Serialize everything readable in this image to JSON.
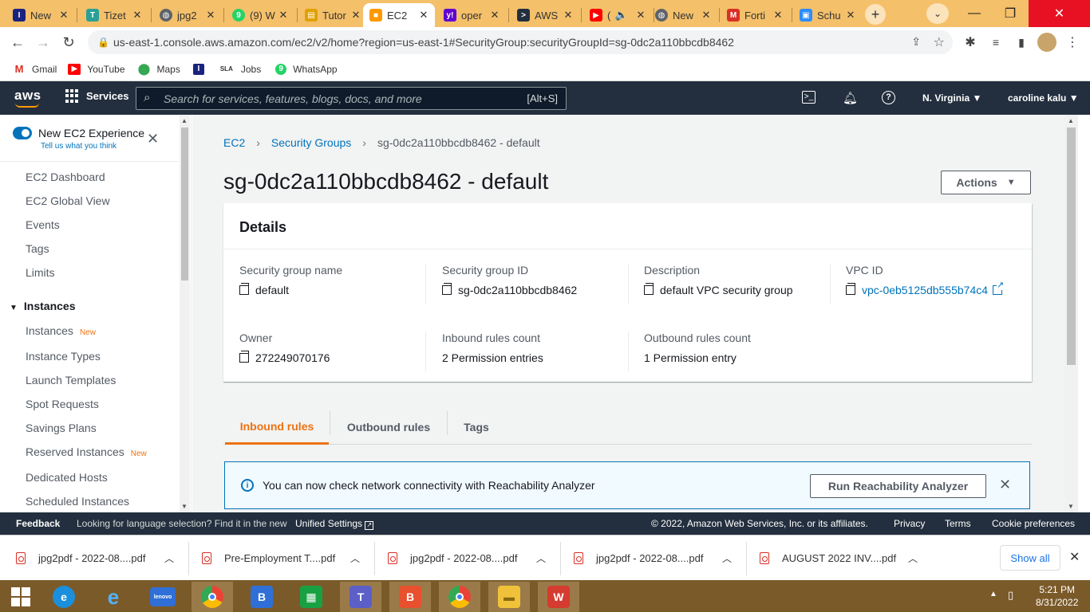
{
  "browser": {
    "tabs": [
      {
        "title": "New",
        "icon": "indeed-icon",
        "color": "#1a237e"
      },
      {
        "title": "Tizet",
        "icon": "tizeti-icon",
        "color": "#2aa198"
      },
      {
        "title": "jpg2",
        "icon": "globe-icon",
        "color": "#5f6368"
      },
      {
        "title": "(9) W",
        "icon": "whatsapp-icon",
        "color": "#25d366"
      },
      {
        "title": "Tutor",
        "icon": "tutorial-icon",
        "color": "#e0a100"
      },
      {
        "title": "EC2",
        "icon": "aws-cube-icon",
        "color": "#ff9900",
        "active": true
      },
      {
        "title": "oper",
        "icon": "yahoo-icon",
        "color": "#5f01d1"
      },
      {
        "title": "AWS",
        "icon": "terminal-icon",
        "color": "#232f3e"
      },
      {
        "title": "(",
        "icon": "youtube-icon",
        "color": "#ff0000"
      },
      {
        "title": "New",
        "icon": "globe-icon",
        "color": "#5f6368"
      },
      {
        "title": "Forti",
        "icon": "gmail-icon",
        "color": "#d93025"
      },
      {
        "title": "Schu",
        "icon": "zoom-icon",
        "color": "#2d8cff"
      }
    ],
    "url": "us-east-1.console.aws.amazon.com/ec2/v2/home?region=us-east-1#SecurityGroup:securityGroupId=sg-0dc2a110bbcdb8462",
    "bookmarks": [
      {
        "label": "Gmail",
        "icon": "gmail-icon"
      },
      {
        "label": "YouTube",
        "icon": "youtube-icon"
      },
      {
        "label": "Maps",
        "icon": "maps-icon"
      },
      {
        "label": "",
        "icon": "indeed-icon"
      },
      {
        "label": "Jobs",
        "icon": "jobs-icon"
      },
      {
        "label": "WhatsApp",
        "icon": "whatsapp-icon"
      }
    ]
  },
  "aws_header": {
    "logo": "aws",
    "services": "Services",
    "search_placeholder": "Search for services, features, blogs, docs, and more",
    "search_shortcut": "[Alt+S]",
    "region": "N. Virginia",
    "user": "caroline kalu"
  },
  "sidebar": {
    "toggle_label": "New EC2 Experience",
    "tell_us": "Tell us what you think",
    "top_items": [
      "EC2 Dashboard",
      "EC2 Global View",
      "Events",
      "Tags",
      "Limits"
    ],
    "section": "Instances",
    "section_items": [
      {
        "label": "Instances",
        "badge": "New"
      },
      {
        "label": "Instance Types",
        "badge": ""
      },
      {
        "label": "Launch Templates",
        "badge": ""
      },
      {
        "label": "Spot Requests",
        "badge": ""
      },
      {
        "label": "Savings Plans",
        "badge": ""
      },
      {
        "label": "Reserved Instances",
        "badge": "New"
      },
      {
        "label": "Dedicated Hosts",
        "badge": ""
      },
      {
        "label": "Scheduled Instances",
        "badge": ""
      }
    ]
  },
  "main": {
    "breadcrumb": [
      "EC2",
      "Security Groups",
      "sg-0dc2a110bbcdb8462 - default"
    ],
    "title": "sg-0dc2a110bbcdb8462 - default",
    "actions_label": "Actions",
    "details": {
      "heading": "Details",
      "fields": [
        {
          "label": "Security group name",
          "value": "default",
          "copy": true
        },
        {
          "label": "Security group ID",
          "value": "sg-0dc2a110bbcdb8462",
          "copy": true
        },
        {
          "label": "Description",
          "value": "default VPC security group",
          "copy": true
        },
        {
          "label": "VPC ID",
          "value": "vpc-0eb5125db555b74c4",
          "copy": true,
          "link": true
        },
        {
          "label": "Owner",
          "value": "272249070176",
          "copy": true
        },
        {
          "label": "Inbound rules count",
          "value": "2 Permission entries"
        },
        {
          "label": "Outbound rules count",
          "value": "1 Permission entry"
        }
      ]
    },
    "tabs": [
      "Inbound rules",
      "Outbound rules",
      "Tags"
    ],
    "active_tab": "Inbound rules",
    "banner": {
      "text": "You can now check network connectivity with Reachability Analyzer",
      "button": "Run Reachability Analyzer"
    }
  },
  "aws_footer": {
    "feedback": "Feedback",
    "lang_text": "Looking for language selection? Find it in the new",
    "lang_link": "Unified Settings",
    "copyright": "© 2022, Amazon Web Services, Inc. or its affiliates.",
    "privacy": "Privacy",
    "terms": "Terms",
    "cookies": "Cookie preferences"
  },
  "downloads": {
    "items": [
      "jpg2pdf - 2022-08....pdf",
      "Pre-Employment T....pdf",
      "jpg2pdf - 2022-08....pdf",
      "jpg2pdf - 2022-08....pdf",
      "AUGUST 2022 INV....pdf"
    ],
    "show_all": "Show all"
  },
  "taskbar": {
    "time": "5:21 PM",
    "date": "8/31/2022"
  },
  "colors": {
    "aws_navy": "#232f3e",
    "aws_orange": "#ec7211",
    "link_blue": "#0073bb",
    "tabstrip": "#f4c06a"
  }
}
